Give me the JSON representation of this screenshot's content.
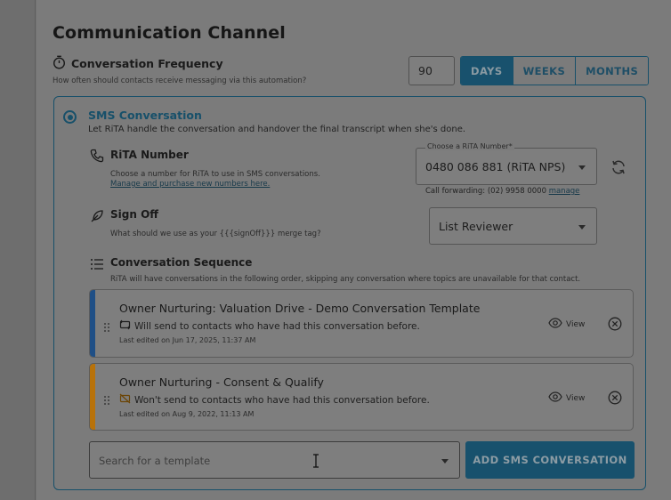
{
  "section": {
    "title": "Communication Channel"
  },
  "frequency": {
    "title": "Conversation Frequency",
    "subtitle": "How often should contacts receive messaging via this automation?",
    "value": "90",
    "units": [
      {
        "label": "DAYS",
        "active": true
      },
      {
        "label": "WEEKS",
        "active": false
      },
      {
        "label": "MONTHS",
        "active": false
      }
    ]
  },
  "sms": {
    "title": "SMS Conversation",
    "description": "Let RiTA handle the conversation and handover the final transcript when she's done.",
    "number": {
      "title": "RiTA Number",
      "subtitle": "Choose a number for RiTA to use in SMS conversations.",
      "link": "Manage and purchase new numbers here.",
      "select_label": "Choose a RiTA Number*",
      "select_value": "0480 086 881 (RiTA NPS)",
      "call_forwarding": "Call forwarding: (02) 9958 0000",
      "manage_link": "manage"
    },
    "signoff": {
      "title": "Sign Off",
      "subtitle": "What should we use as your {{{signOff}}} merge tag?",
      "select_value": "List Reviewer"
    },
    "sequence": {
      "title": "Conversation Sequence",
      "subtitle": "RiTA will have conversations in the following order, skipping any conversation where topics are unavailable for that contact.",
      "items": [
        {
          "title": "Owner Nurturing: Valuation Drive - Demo Conversation Template",
          "status": "Will send to contacts who have had this conversation before.",
          "edited": "Last edited on Jun 17, 2025, 11:37 AM",
          "view_label": "View",
          "accent": "#1f4f86"
        },
        {
          "title": "Owner Nurturing - Consent & Qualify",
          "status": "Won't send to contacts who have had this conversation before.",
          "edited": "Last edited on Aug 9, 2022, 11:13 AM",
          "view_label": "View",
          "accent": "#b8720a"
        }
      ]
    },
    "search_placeholder": "Search for a template",
    "add_button": "ADD SMS CONVERSATION"
  },
  "colors": {
    "accent": "#18516d",
    "overlay_bg": "#7b7b7b"
  }
}
